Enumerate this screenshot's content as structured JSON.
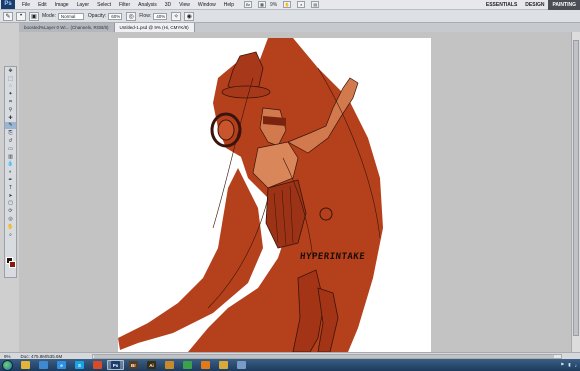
{
  "app": {
    "logo": "Ps"
  },
  "menu": [
    "File",
    "Edit",
    "Image",
    "Layer",
    "Select",
    "Filter",
    "Analysis",
    "3D",
    "View",
    "Window",
    "Help"
  ],
  "menubar_extras": {
    "zoom": "9%"
  },
  "workspaces": [
    {
      "label": "ESSENTIALS"
    },
    {
      "label": "DESIGN"
    },
    {
      "label": "PAINTING",
      "active": true
    }
  ],
  "options": {
    "mode_label": "Mode:",
    "mode_value": "Normal",
    "opacity_label": "Opacity:",
    "opacity_value": "60%",
    "flow_label": "Flow:",
    "flow_value": "40%"
  },
  "tabs": [
    {
      "label": "boosted%Layer 0 Wi... (Channels, RGB/8)"
    },
    {
      "label": "Untitled-1.psd @ 9% (Hi, CMYK/8)",
      "active": true
    }
  ],
  "canvas": {
    "signature_text": "HYPERINTAKE"
  },
  "status": {
    "zoom": "9%",
    "doc_size": "Doc: 475.8M/535.6M"
  },
  "taskbar": {
    "apps": [
      {
        "icon": "folder-icon",
        "label": "",
        "color": "#e3b33a"
      },
      {
        "icon": "media-icon",
        "label": "",
        "color": "#3d8ad1"
      },
      {
        "icon": "ie-icon",
        "label": "e",
        "color": "#2f8fe0"
      },
      {
        "icon": "skype-icon",
        "label": "S",
        "color": "#1aa2e6"
      },
      {
        "icon": "browser-icon",
        "label": "",
        "color": "#d84b2a"
      },
      {
        "icon": "photoshop-icon",
        "label": "Ps",
        "color": "#1b3d6e",
        "active": true
      },
      {
        "icon": "bridge-icon",
        "label": "Br",
        "color": "#5c3a1a"
      },
      {
        "icon": "illustrator-icon",
        "label": "Ai",
        "color": "#3a2a10"
      },
      {
        "icon": "paint-icon",
        "label": "",
        "color": "#c98a2a"
      },
      {
        "icon": "chrome-icon",
        "label": "",
        "color": "#3aa34a"
      },
      {
        "icon": "media-player-icon",
        "label": "",
        "color": "#e07a1a"
      },
      {
        "icon": "folder2-icon",
        "label": "",
        "color": "#d9a93a"
      },
      {
        "icon": "app-icon",
        "label": "",
        "color": "#7a9ac8"
      }
    ]
  },
  "colors": {
    "foreground": "#2b0f06",
    "background": "#8b1a0a",
    "artwork_fill": "#b5401c"
  }
}
